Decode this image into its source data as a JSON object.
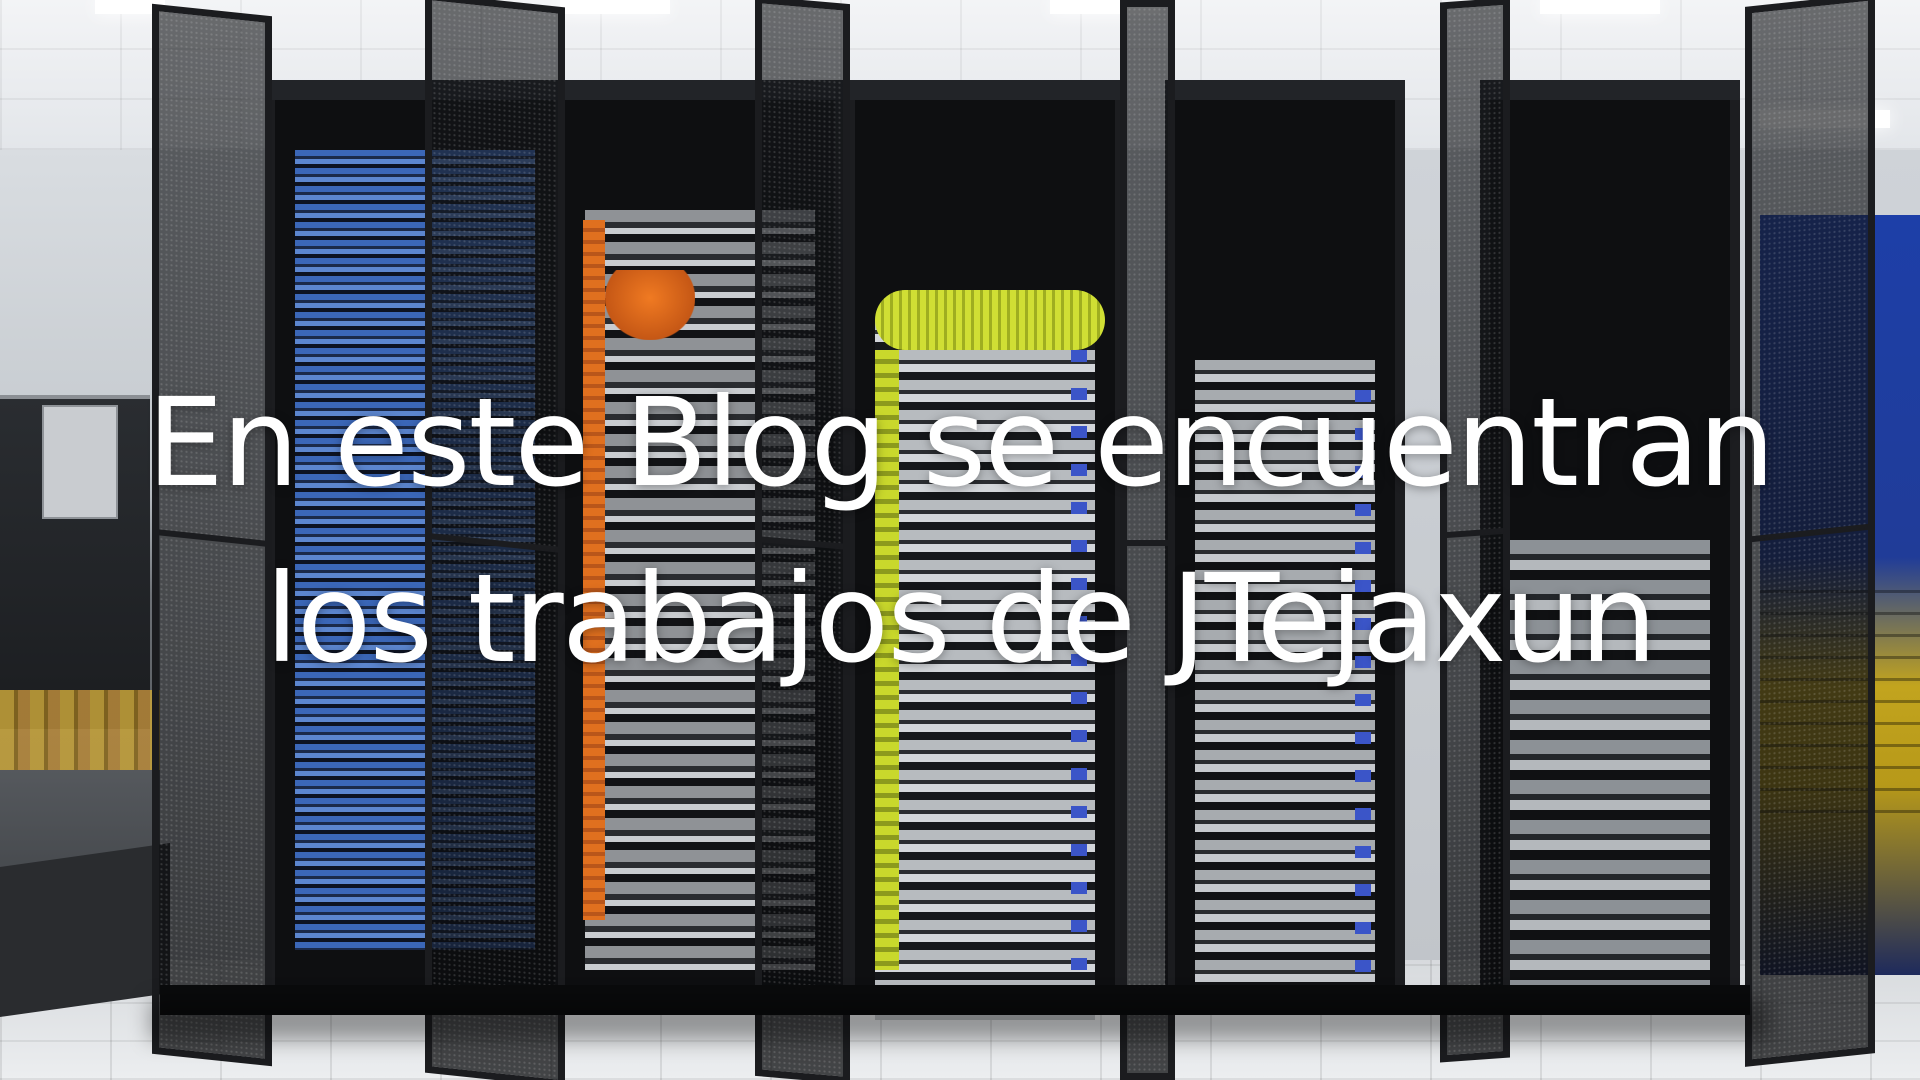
{
  "headline": {
    "line1": "En este Blog se encuentran",
    "line2": "los trabajos de JTejaxun"
  },
  "background": {
    "subject": "supercomputer server racks with open mesh doors",
    "colors": {
      "rack": "#0e0f11",
      "cable_orange": "#e0701f",
      "cable_yellow": "#c9d82c",
      "server_blue": "#2f5fb5",
      "cabinet_blue": "#1d3fa8",
      "floor": "#e5e7ea"
    }
  }
}
